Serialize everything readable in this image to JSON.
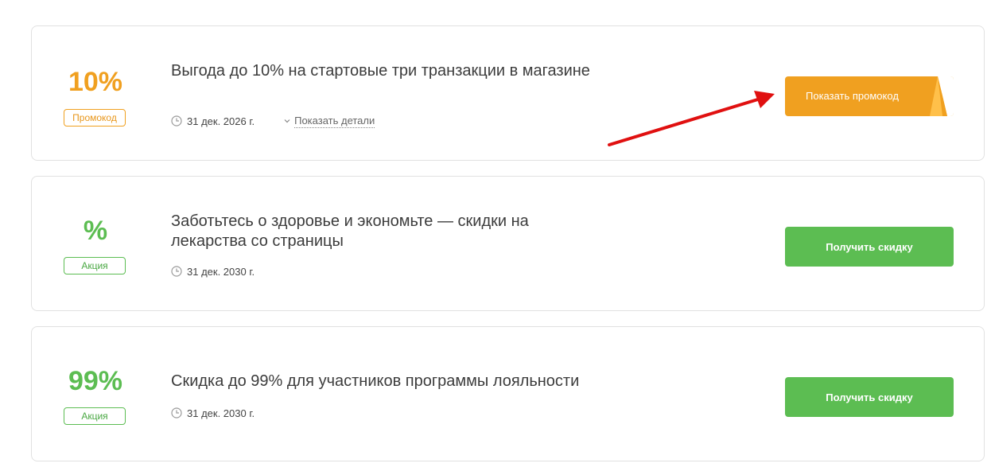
{
  "offers": [
    {
      "value": "10%",
      "badge": "Промокод",
      "title": "Выгода до 10% на стартовые три транзакции в магазине",
      "date": "31 дек. 2026 г.",
      "details_label": "Показать детали",
      "button_label": "Показать промокод"
    },
    {
      "value": "%",
      "badge": "Акция",
      "title": "Заботьтесь о здоровье и экономьте — скидки на лекарства со страницы",
      "date": "31 дек. 2030 г.",
      "button_label": "Получить скидку"
    },
    {
      "value": "99%",
      "badge": "Акция",
      "title": "Скидка до 99% для участников программы лояльности",
      "date": "31 дек. 2030 г.",
      "button_label": "Получить скидку"
    }
  ],
  "colors": {
    "promo_accent": "#f0a020",
    "deal_accent": "#5cbd52",
    "annotation_arrow": "#e01010"
  },
  "icons": {
    "date": "clock-icon",
    "details": "chevron-down-icon"
  }
}
